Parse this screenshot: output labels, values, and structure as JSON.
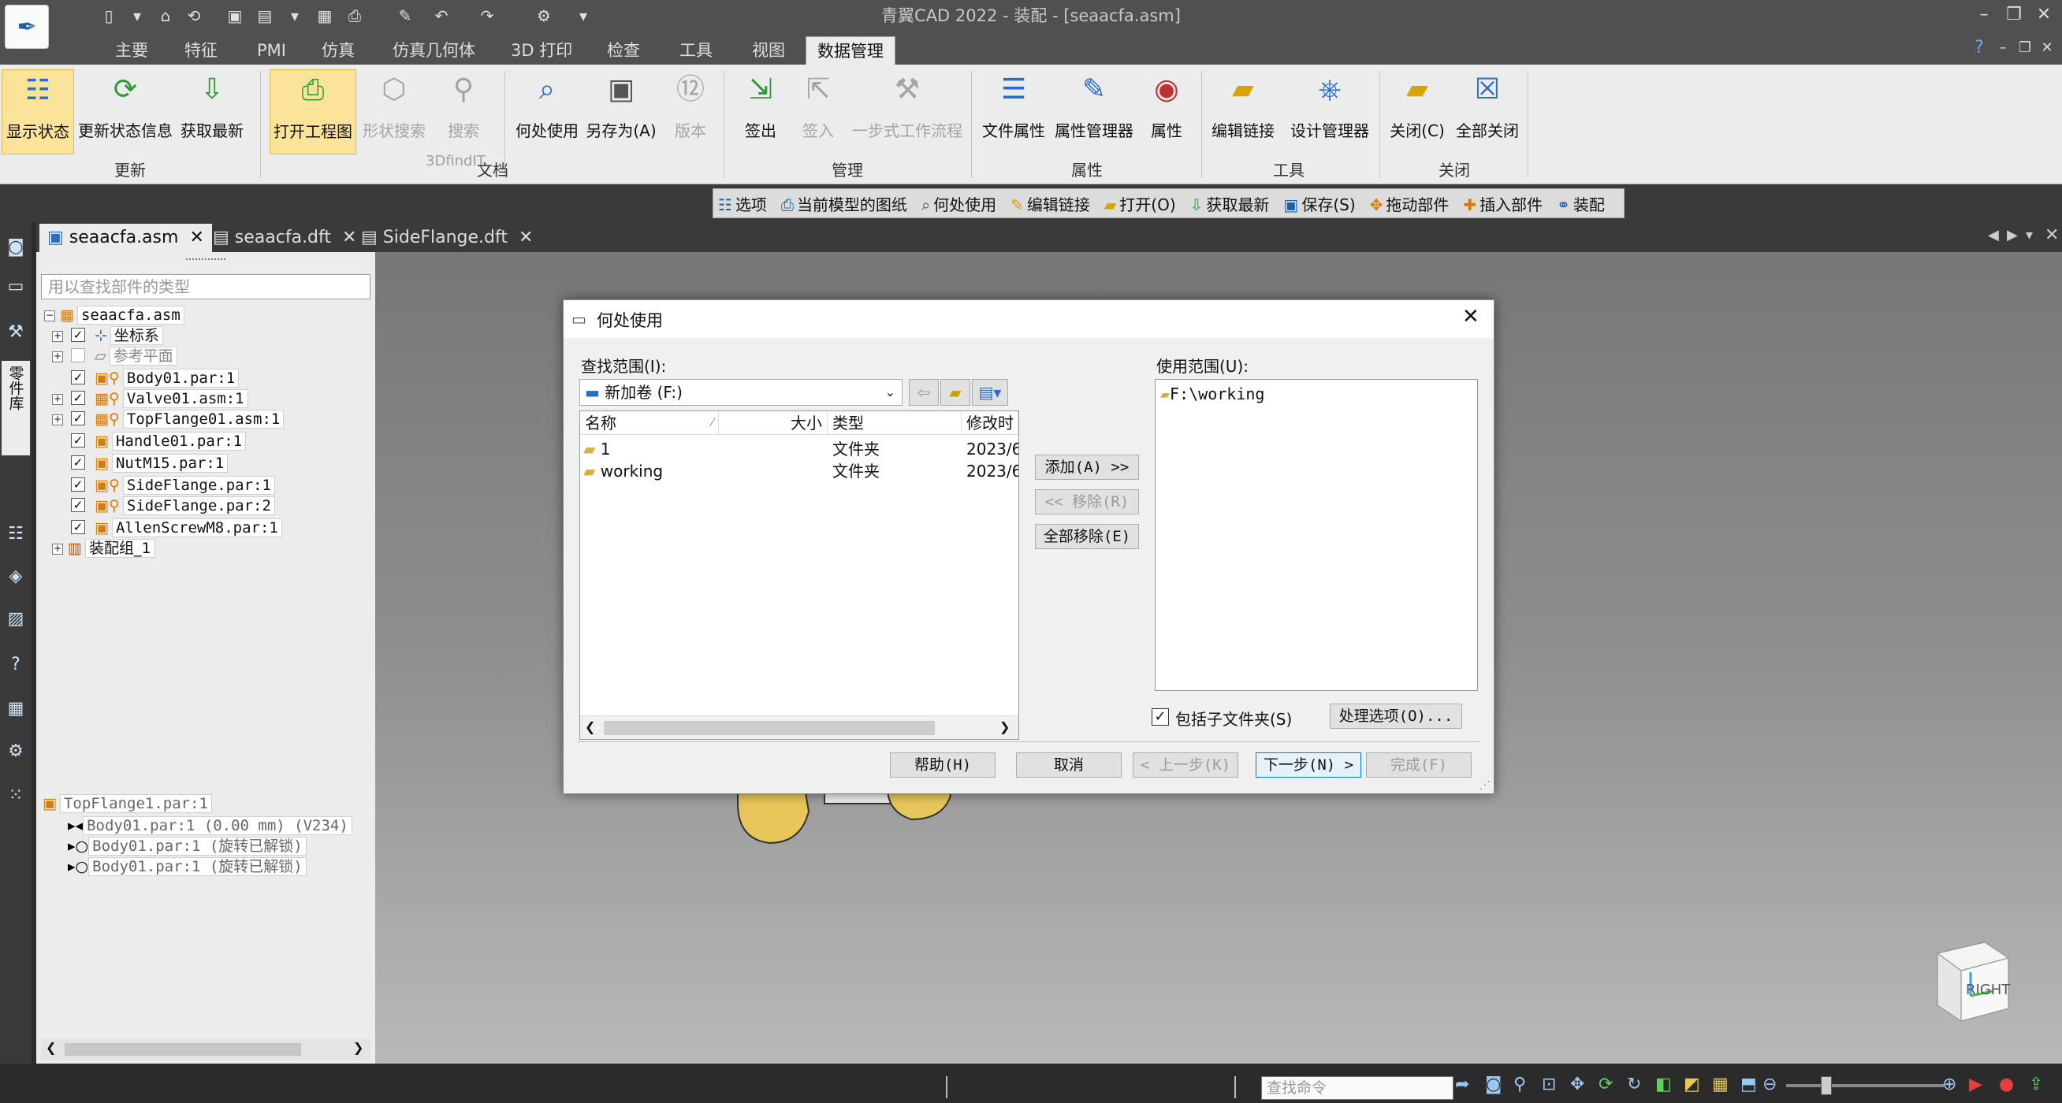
{
  "app": {
    "title": "青翼CAD 2022 - 装配 - [seaacfa.asm]",
    "help_label": "?"
  },
  "tabs": [
    "主要",
    "特征",
    "PMI",
    "仿真",
    "仿真几何体",
    "3D 打印",
    "检查",
    "工具",
    "视图",
    "数据管理"
  ],
  "active_tab": "数据管理",
  "ribbon": {
    "buttons": [
      {
        "label": "显示状态",
        "icon": "display-status-icon"
      },
      {
        "label": "更新状态信息",
        "icon": "refresh-status-icon"
      },
      {
        "label": "获取最新",
        "icon": "get-latest-icon"
      },
      {
        "label": "打开工程图",
        "icon": "open-drawing-icon"
      },
      {
        "label": "形状搜索",
        "icon": "shape-search-icon"
      },
      {
        "label": "搜索",
        "icon": "search-icon"
      },
      {
        "label": "3DfindIT",
        "icon": "3dfindit-icon"
      },
      {
        "label": "何处使用",
        "icon": "where-used-icon"
      },
      {
        "label": "另存为(A)",
        "icon": "save-as-icon"
      },
      {
        "label": "版本",
        "icon": "version-icon"
      },
      {
        "label": "签出",
        "icon": "check-out-icon"
      },
      {
        "label": "签入",
        "icon": "check-in-icon"
      },
      {
        "label": "一步式工作流程",
        "icon": "workflow-icon"
      },
      {
        "label": "文件属性",
        "icon": "file-properties-icon"
      },
      {
        "label": "属性管理器",
        "icon": "property-manager-icon"
      },
      {
        "label": "属性",
        "icon": "properties-icon"
      },
      {
        "label": "编辑链接",
        "icon": "edit-links-icon"
      },
      {
        "label": "设计管理器",
        "icon": "design-manager-icon"
      },
      {
        "label": "关闭(C)",
        "icon": "close-folder-icon"
      },
      {
        "label": "全部关闭",
        "icon": "close-all-icon"
      }
    ],
    "groups": [
      "更新",
      "文档",
      "管理",
      "属性",
      "工具",
      "关闭"
    ]
  },
  "command_bar": [
    "选项",
    "当前模型的图纸",
    "何处使用",
    "编辑链接",
    "打开(O)",
    "获取最新",
    "保存(S)",
    "拖动部件",
    "插入部件",
    "装配"
  ],
  "doc_tabs": [
    "seaacfa.asm",
    "seaacfa.dft",
    "SideFlange.dft"
  ],
  "pane": {
    "search_placeholder": "用以查找部件的类型",
    "tree": [
      "seaacfa.asm",
      "坐标系",
      "参考平面",
      "Body01.par:1",
      "Valve01.asm:1",
      "TopFlange01.asm:1",
      "Handle01.par:1",
      "NutM15.par:1",
      "SideFlange.par:1",
      "SideFlange.par:2",
      "AllenScrewM8.par:1",
      "装配组_1"
    ],
    "relations_title": "TopFlange1.par:1",
    "relations": [
      "Body01.par:1  (0.00 mm)  (V234)",
      "Body01.par:1  (旋转已解锁)",
      "Body01.par:1  (旋转已解锁)"
    ],
    "vertical_tab": "零件库"
  },
  "status_bar": {
    "search_placeholder": "查找命令"
  },
  "viewcube_label": "RIGHT",
  "dialog": {
    "title": "何处使用",
    "lookin_label": "查找范围(I):",
    "lookin_value": "新加卷 (F:)",
    "columns": [
      "名称",
      "大小",
      "类型",
      "修改时"
    ],
    "files": [
      {
        "name": "1",
        "type": "文件夹",
        "modified": "2023/6"
      },
      {
        "name": "working",
        "type": "文件夹",
        "modified": "2023/6"
      }
    ],
    "add_label": "添加(A) >>",
    "remove_label": "<< 移除(R)",
    "remove_all_label": "全部移除(E)",
    "scope_label": "使用范围(U):",
    "scope_items": [
      "F:\\working"
    ],
    "include_subfolders_label": "包括子文件夹(S)",
    "include_subfolders": true,
    "options_label": "处理选项(O)...",
    "help_label": "帮助(H)",
    "cancel_label": "取消",
    "back_label": "< 上一步(K)",
    "next_label": "下一步(N) >",
    "finish_label": "完成(F)"
  }
}
